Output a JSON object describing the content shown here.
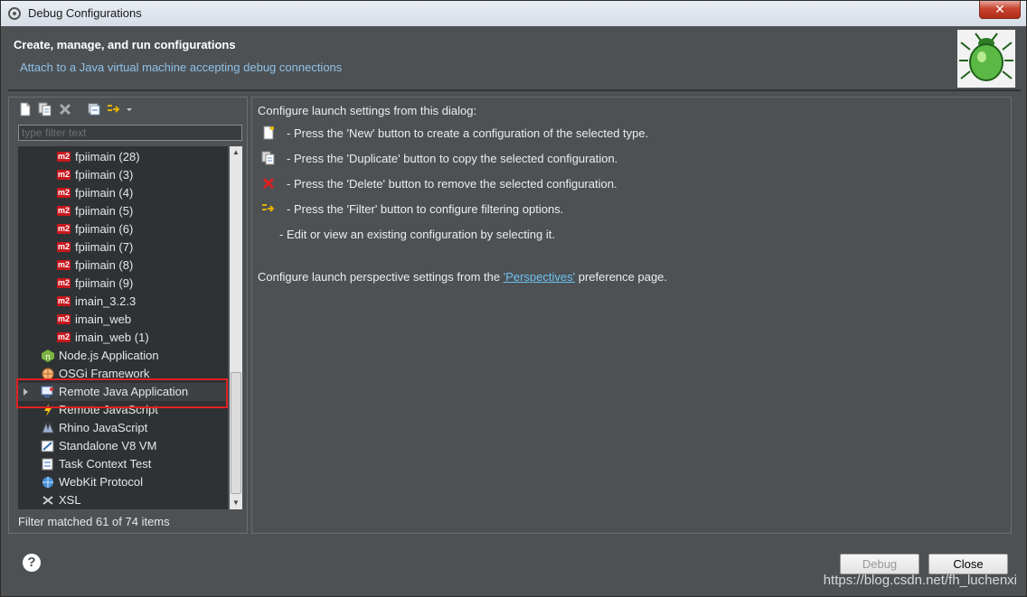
{
  "window": {
    "title": "Debug Configurations",
    "close_glyph": "✕"
  },
  "header": {
    "title": "Create, manage, and run configurations",
    "subtitle": "Attach to a Java virtual machine accepting debug connections",
    "image_icon": "bug-icon"
  },
  "left": {
    "toolbar": [
      "new-config-icon",
      "duplicate-icon",
      "delete-icon",
      "collapse-all-icon",
      "filter-icon",
      "dropdown-arrow-icon"
    ],
    "filter_placeholder": "type filter text",
    "tree": [
      {
        "label": "fpiimain (28)",
        "icon": "m2-icon",
        "indent": 2
      },
      {
        "label": "fpiimain (3)",
        "icon": "m2-icon",
        "indent": 2
      },
      {
        "label": "fpiimain (4)",
        "icon": "m2-icon",
        "indent": 2
      },
      {
        "label": "fpiimain (5)",
        "icon": "m2-icon",
        "indent": 2
      },
      {
        "label": "fpiimain (6)",
        "icon": "m2-icon",
        "indent": 2
      },
      {
        "label": "fpiimain (7)",
        "icon": "m2-icon",
        "indent": 2
      },
      {
        "label": "fpiimain (8)",
        "icon": "m2-icon",
        "indent": 2
      },
      {
        "label": "fpiimain (9)",
        "icon": "m2-icon",
        "indent": 2
      },
      {
        "label": "imain_3.2.3",
        "icon": "m2-icon",
        "indent": 2
      },
      {
        "label": "imain_web",
        "icon": "m2-icon",
        "indent": 2
      },
      {
        "label": "imain_web (1)",
        "icon": "m2-icon",
        "indent": 2
      },
      {
        "label": "Node.js Application",
        "icon": "nodejs-icon",
        "indent": 1
      },
      {
        "label": "OSGi Framework",
        "icon": "osgi-icon",
        "indent": 1
      },
      {
        "label": "Remote Java Application",
        "icon": "remote-java-icon",
        "indent": 1,
        "selected": true,
        "expandable": true
      },
      {
        "label": "Remote JavaScript",
        "icon": "remote-js-icon",
        "indent": 1
      },
      {
        "label": "Rhino JavaScript",
        "icon": "rhino-icon",
        "indent": 1
      },
      {
        "label": "Standalone V8 VM",
        "icon": "v8-icon",
        "indent": 1
      },
      {
        "label": "Task Context Test",
        "icon": "task-icon",
        "indent": 1
      },
      {
        "label": "WebKit Protocol",
        "icon": "webkit-icon",
        "indent": 1
      },
      {
        "label": "XSL",
        "icon": "xsl-icon",
        "indent": 1
      }
    ],
    "status": "Filter matched 61 of 74 items"
  },
  "right": {
    "intro": "Configure launch settings from this dialog:",
    "items": [
      {
        "icon": "new-config-icon",
        "text": "- Press the 'New' button to create a configuration of the selected type."
      },
      {
        "icon": "duplicate-icon",
        "text": "- Press the 'Duplicate' button to copy the selected configuration."
      },
      {
        "icon": "delete-icon",
        "text": "- Press the 'Delete' button to remove the selected configuration."
      },
      {
        "icon": "filter-icon",
        "text": "- Press the 'Filter' button to configure filtering options."
      },
      {
        "icon": "",
        "text": "- Edit or view an existing configuration by selecting it."
      }
    ],
    "perspectives_prefix": "Configure launch perspective settings from the",
    "perspectives_link": "'Perspectives'",
    "perspectives_suffix": "preference page."
  },
  "footer": {
    "help_glyph": "?",
    "debug_label": "Debug",
    "close_label": "Close",
    "watermark": "https://blog.csdn.net/fh_luchenxi"
  }
}
